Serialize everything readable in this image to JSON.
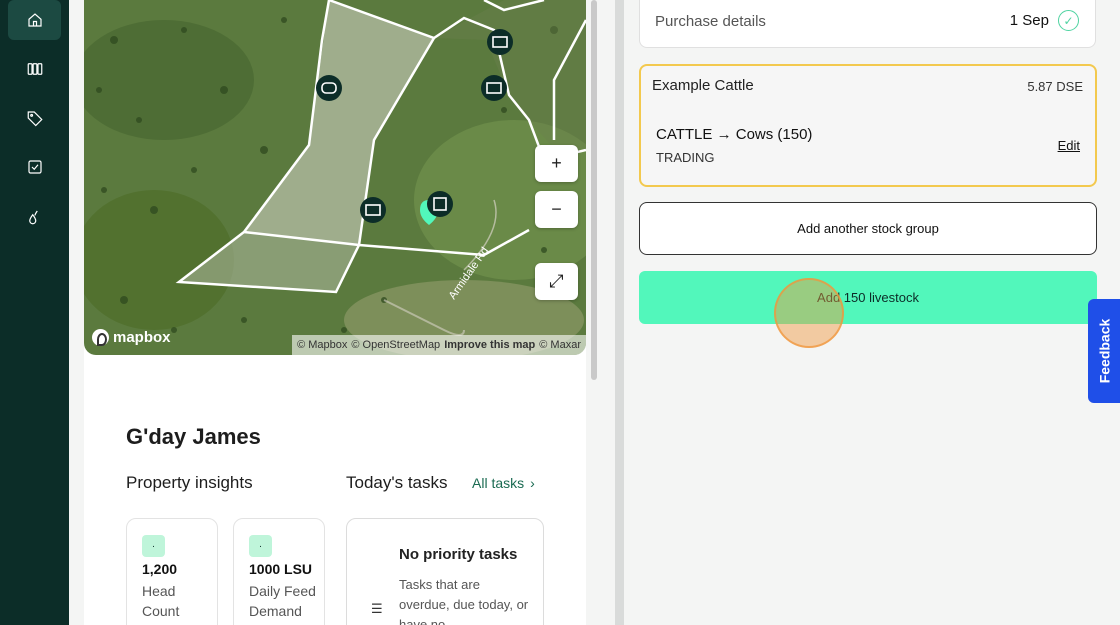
{
  "sidebar": {
    "items": [
      {
        "icon": "home-icon",
        "active": true
      },
      {
        "icon": "paddocks-icon",
        "active": false
      },
      {
        "icon": "tag-icon",
        "active": false
      },
      {
        "icon": "checklist-icon",
        "active": false
      },
      {
        "icon": "drops-icon",
        "active": false
      }
    ]
  },
  "map": {
    "zoom_in": "+",
    "zoom_out": "−",
    "fullscreen": "⤢",
    "logo": "mapbox",
    "road_label": "Armidale Rd",
    "attribution": {
      "mapbox": "© Mapbox",
      "osm": "© OpenStreetMap",
      "improve": "Improve this map",
      "maxar": "© Maxar"
    }
  },
  "dashboard": {
    "greeting": "G'day James",
    "insights_title": "Property insights",
    "tasks_title": "Today's tasks",
    "all_tasks": "All tasks",
    "stats": [
      {
        "chip": "·",
        "value": "1,200",
        "label": "Head Count"
      },
      {
        "chip": "·",
        "value": "1000  LSU",
        "label": "Daily Feed Demand"
      }
    ],
    "tasks_box": {
      "title": "No priority tasks",
      "text": "Tasks that are overdue, due today, or have no"
    }
  },
  "panel": {
    "purchase_label": "Purchase details",
    "purchase_date": "1 Sep",
    "stock_group": {
      "name": "Example Cattle",
      "dse": "5.87 DSE",
      "type": "CATTLE → Cows (150)",
      "category": "TRADING",
      "edit": "Edit"
    },
    "add_group": "Add another stock group",
    "add_livestock": "Add 150 livestock"
  },
  "feedback": "Feedback",
  "colors": {
    "sidebar": "#0c2d28",
    "accent": "#52f7bb",
    "highlight_border": "#f3c94e",
    "feedback": "#1f4fe8"
  }
}
